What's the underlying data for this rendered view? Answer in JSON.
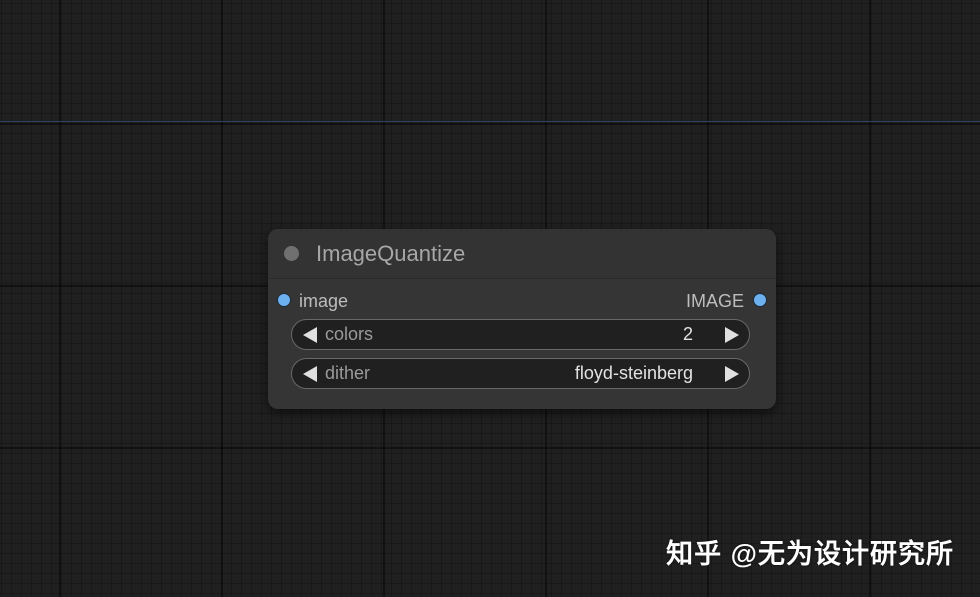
{
  "node": {
    "title": "ImageQuantize",
    "input": {
      "label": "image"
    },
    "output": {
      "label": "IMAGE"
    },
    "widgets": [
      {
        "label": "colors",
        "value": "2"
      },
      {
        "label": "dither",
        "value": "floyd-steinberg"
      }
    ]
  },
  "watermark": "知乎 @无为设计研究所",
  "colors": {
    "canvas_bg": "#202020",
    "node_bg": "#353535",
    "slot": "#6db0f0",
    "guide_line": "#2b3f63"
  }
}
